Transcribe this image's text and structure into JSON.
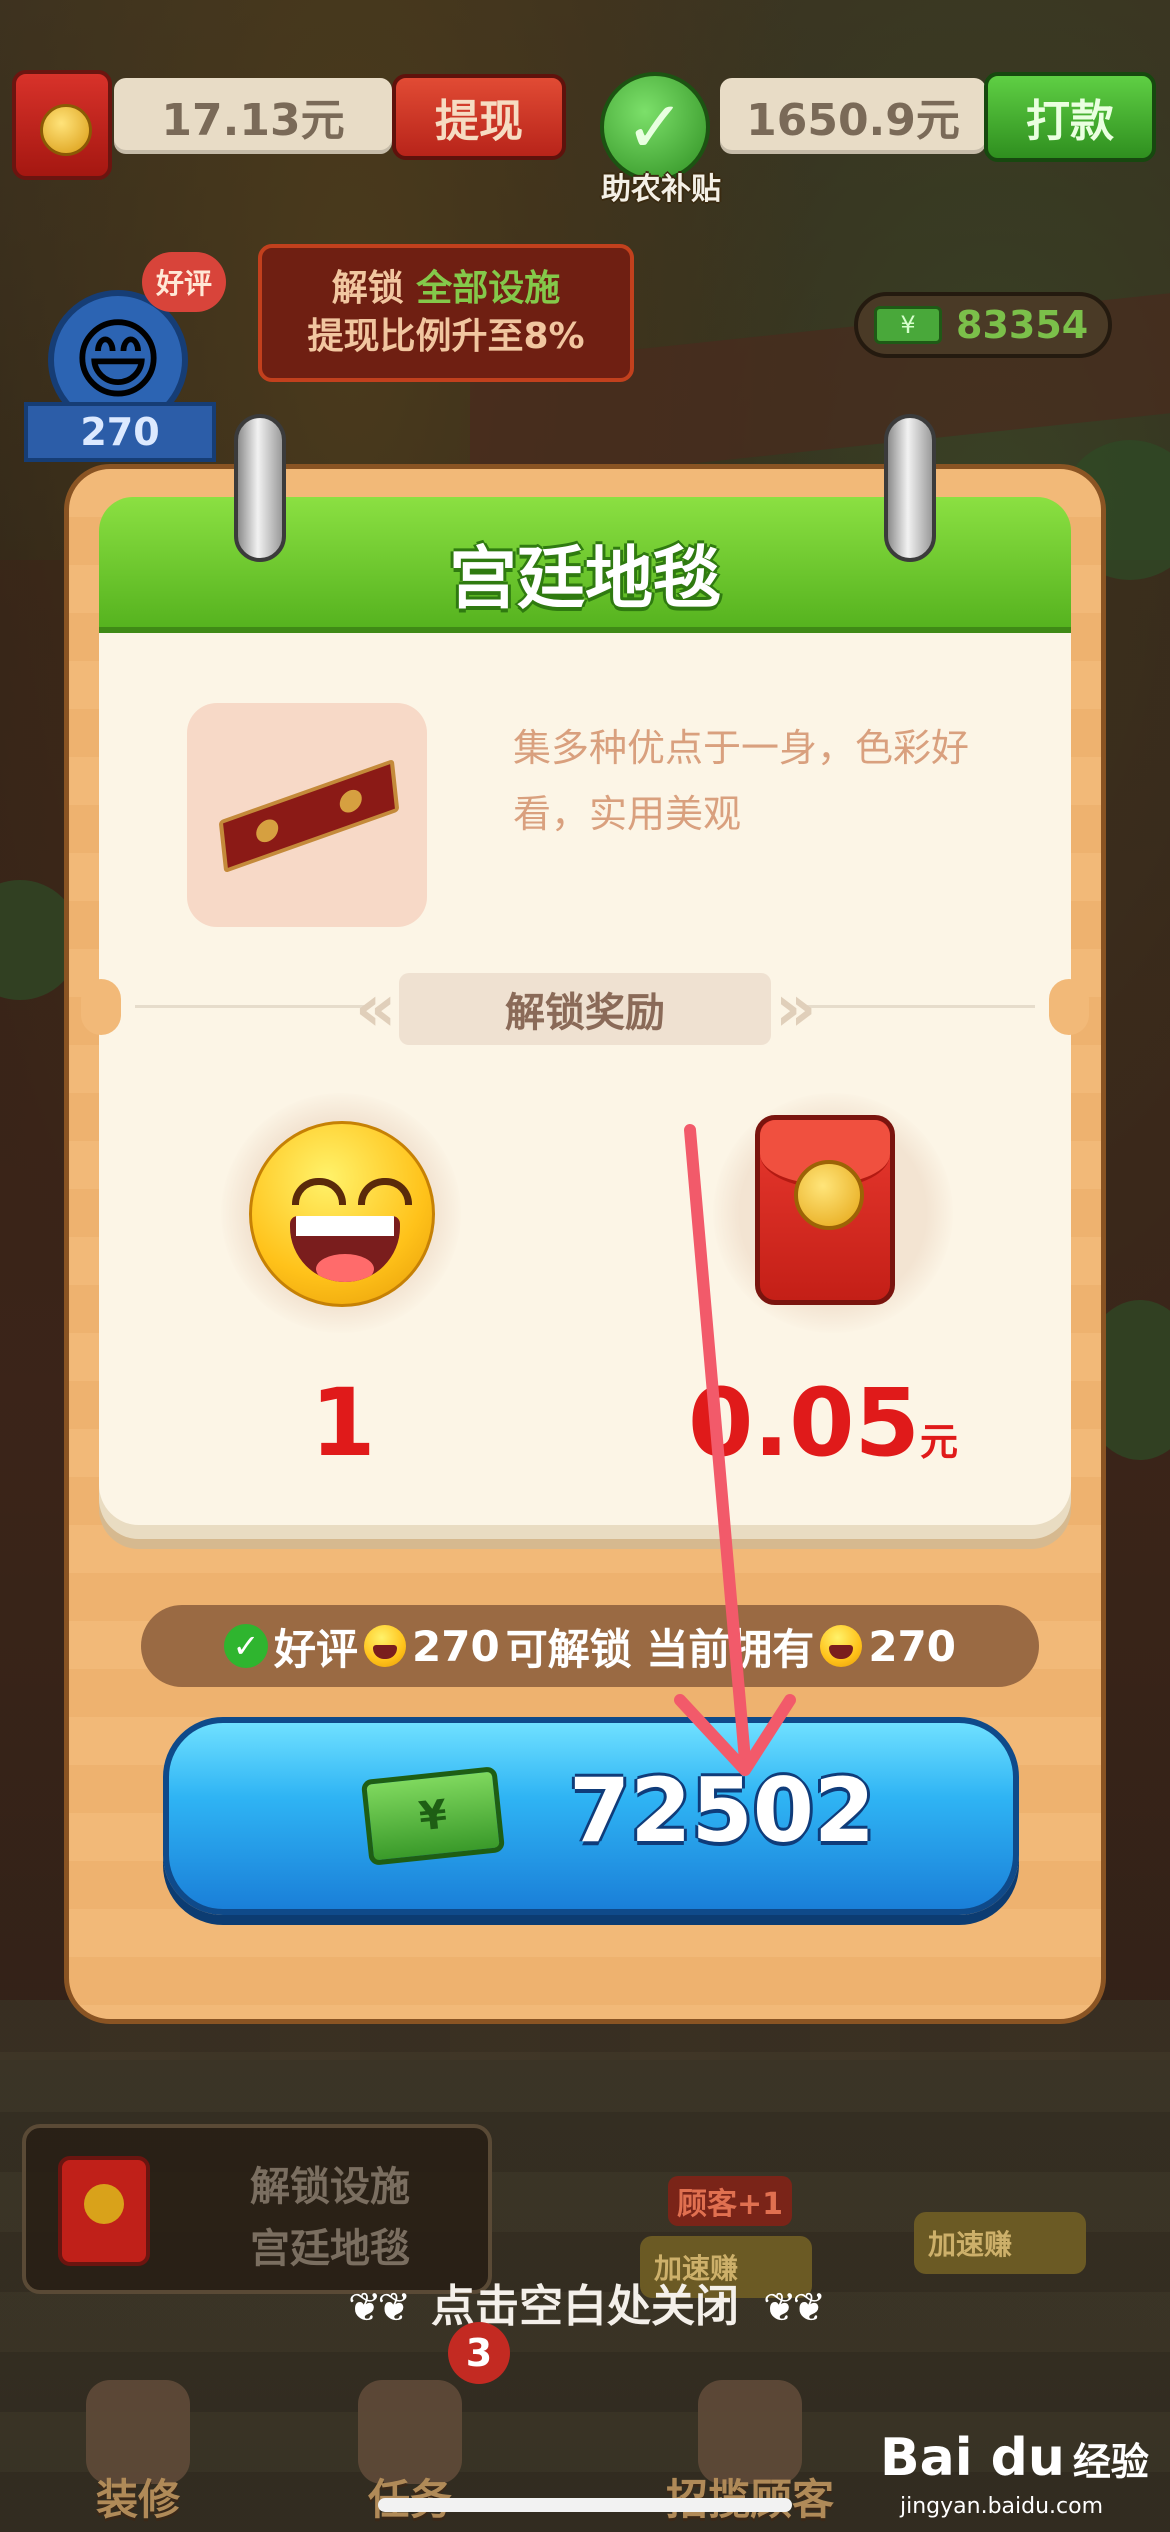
{
  "hud": {
    "balance": "17.13元",
    "withdraw_label": "提现",
    "subsidy_label": "助农补贴",
    "subsidy_amount": "1650.9元",
    "pay_label": "打款",
    "promo_line1_prefix": "解锁",
    "promo_line1_highlight": "全部设施",
    "promo_line2": "提现比例升至8%",
    "cash": "83354",
    "good_review_badge": "好评",
    "level": "270"
  },
  "modal": {
    "title": "宫廷地毯",
    "description": "集多种优点于一身，色彩好看，实用美观",
    "reward_header": "解锁奖励",
    "rewards": [
      {
        "icon": "smiley-face-icon",
        "value": "1",
        "unit": ""
      },
      {
        "icon": "red-envelope-icon",
        "value": "0.05",
        "unit": "元"
      }
    ],
    "requirement": {
      "label": "好评",
      "need": "270",
      "middle": "可解锁 当前拥有",
      "have": "270"
    },
    "buy_price": "72502"
  },
  "bottom": {
    "task_line1": "解锁设施",
    "task_line2": "宫廷地毯",
    "customer_tag": "顾客+1",
    "speed_left": "加速赚",
    "speed_right": "加速赚",
    "close_hint": "点击空白处关闭",
    "nav": [
      {
        "label": "装修"
      },
      {
        "label": "任务",
        "badge": "3"
      },
      {
        "label": "招揽顾客"
      }
    ]
  },
  "watermark": {
    "brand": "Bai du",
    "brand_cn": "经验",
    "url": "jingyan.baidu.com"
  },
  "colors": {
    "accent_green": "#56b31f",
    "button_blue": "#2fb4f4",
    "reward_red": "#e01a1a",
    "annotation_arrow": "#f25a6a"
  }
}
